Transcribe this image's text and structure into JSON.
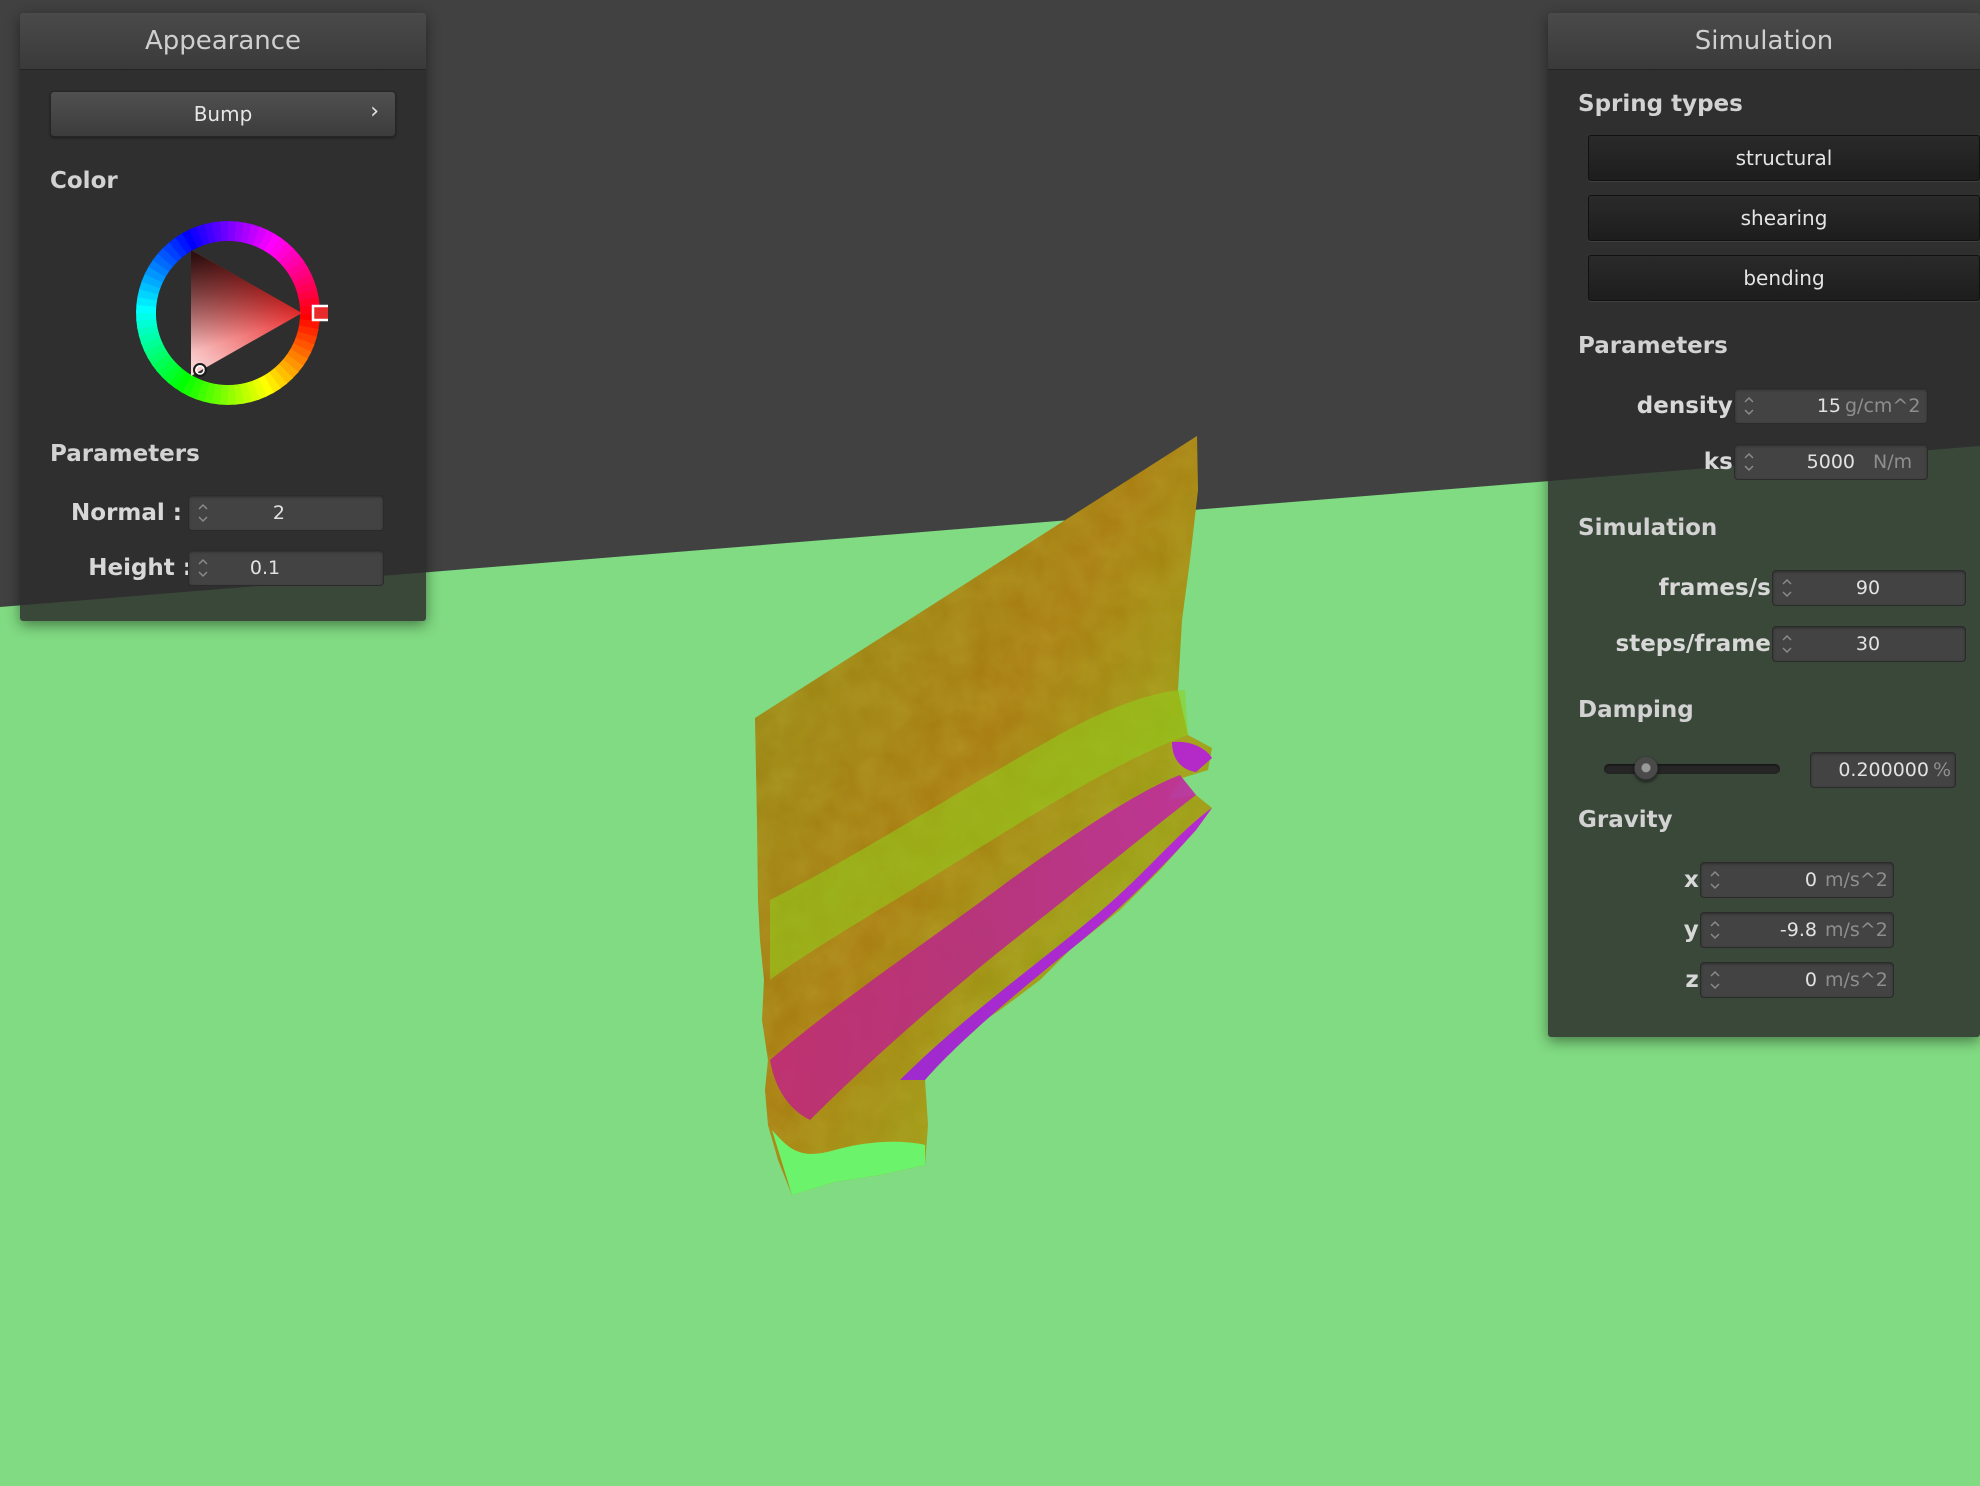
{
  "appearance": {
    "title": "Appearance",
    "shader_select": {
      "label": "Bump",
      "chevron": "›"
    },
    "color_label": "Color",
    "parameters_label": "Parameters",
    "normal": {
      "label": "Normal :",
      "value": "2"
    },
    "height": {
      "label": "Height :",
      "value": "0.1"
    },
    "selected_color": "#e82a2a"
  },
  "simulation": {
    "title": "Simulation",
    "spring_types_label": "Spring types",
    "spring_buttons": [
      "structural",
      "shearing",
      "bending"
    ],
    "parameters_label": "Parameters",
    "density": {
      "label": "density :",
      "value": "15",
      "unit": "g/cm^2"
    },
    "ks": {
      "label": "ks :",
      "value": "5000",
      "unit": "N/m"
    },
    "simulation_label": "Simulation",
    "frames_per_sec": {
      "label": "frames/s :",
      "value": "90"
    },
    "steps_per_frame": {
      "label": "steps/frame :",
      "value": "30"
    },
    "damping_label": "Damping",
    "damping": {
      "value": "0.200000",
      "unit": "%",
      "slider_fraction": 0.2
    },
    "gravity_label": "Gravity",
    "gravity_x": {
      "label": "x :",
      "value": "0",
      "unit": "m/s^2"
    },
    "gravity_y": {
      "label": "y :",
      "value": "-9.8",
      "unit": "m/s^2"
    },
    "gravity_z": {
      "label": "z :",
      "value": "0",
      "unit": "m/s^2"
    }
  },
  "scene": {
    "background_color": "#414141",
    "floor_color": "#80db82",
    "cloth_colors": [
      "#9a9a1c",
      "#a5660c",
      "#8fd01c",
      "#c22a7c",
      "#a528cc",
      "#6cf36c"
    ]
  }
}
